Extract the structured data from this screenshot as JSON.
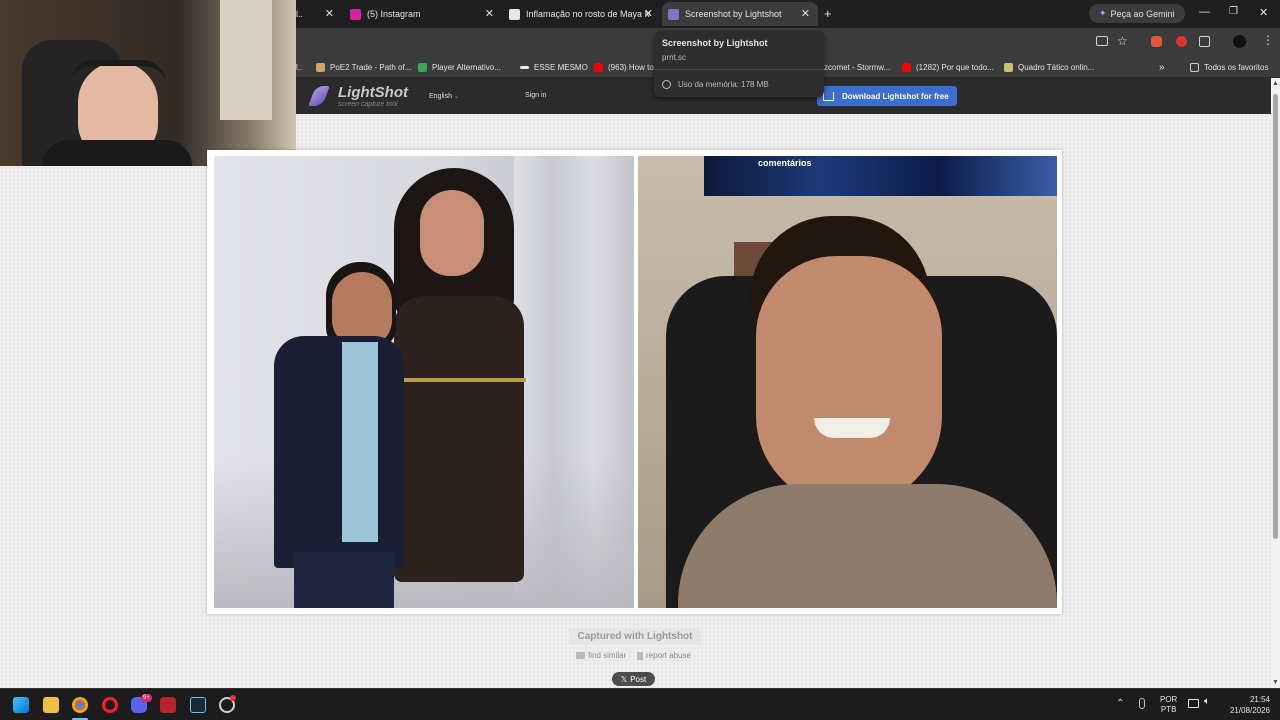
{
  "browser": {
    "tabs": [
      {
        "label": "",
        "favicon_color": "#6a6a6a"
      },
      {
        "label": "(5) Instagram",
        "favicon_color": "#d6249f"
      },
      {
        "label": "Inflamação no rosto de Maya M",
        "favicon_color": "#e6e6e6"
      },
      {
        "label": "Screenshot by Lightshot",
        "favicon_color": "#8a6fc9"
      }
    ],
    "gemini_label": "Peça ao Gemini",
    "tooltip": {
      "title": "Screenshot by Lightshot",
      "url": "prnt.sc",
      "memory": "Uso da memória: 178 MB"
    },
    "bookmarks": [
      {
        "label": "",
        "color": "#777777"
      },
      {
        "label": "PoE2 Trade - Path of...",
        "color": "#c9a86a"
      },
      {
        "label": "Player Alternativo...",
        "color": "#3aa757"
      },
      {
        "label": "ESSE MESMO",
        "color": "#e8e8e8"
      },
      {
        "label": "(963) How to",
        "color": "#ff0000"
      },
      {
        "label": "zcomet - Stormw...",
        "color": "#888888"
      },
      {
        "label": "(1282) Por que todo...",
        "color": "#ff0000"
      },
      {
        "label": "Quadro Tático onlin...",
        "color": "#c8c26a"
      }
    ],
    "all_bookmarks": "Todos os favoritos"
  },
  "lightshot": {
    "logo": "LightShot",
    "tagline": "screen capture tool",
    "language": "English",
    "sign_in": "Sign in",
    "download": "Download Lightshot for free",
    "overlay_label": "comentários",
    "captured_with": "Captured with Lightshot",
    "find_similar": "find similar",
    "report_abuse": "report abuse",
    "post": "Post"
  },
  "taskbar": {
    "lang_top": "POR",
    "lang_bottom": "PTB",
    "time": "21:54",
    "date": "21/08/2026",
    "discord_badge": "9+"
  }
}
